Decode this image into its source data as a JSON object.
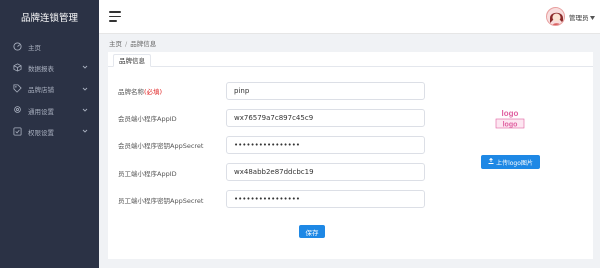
{
  "sidebar": {
    "brand": "品牌连锁管理",
    "items": [
      {
        "label": "主页",
        "icon": "dashboard-icon",
        "has_caret": false
      },
      {
        "label": "数据报表",
        "icon": "cube-icon",
        "has_caret": true
      },
      {
        "label": "品牌店铺",
        "icon": "tag-icon",
        "has_caret": true
      },
      {
        "label": "通用设置",
        "icon": "gear-icon",
        "has_caret": true
      },
      {
        "label": "权限设置",
        "icon": "checkbox-icon",
        "has_caret": true
      }
    ]
  },
  "header": {
    "user_name": "管理员"
  },
  "breadcrumb": {
    "home": "主页",
    "separator": "/",
    "current": "品牌信息"
  },
  "tabs": [
    {
      "label": "品牌信息",
      "active": true
    }
  ],
  "form": {
    "fields": [
      {
        "label": "品牌名称",
        "required_note": "(必填)",
        "value": "pinp",
        "type": "text"
      },
      {
        "label": "会员端小程序AppID",
        "required_note": "",
        "value": "wx76579a7c897c45c9",
        "type": "text"
      },
      {
        "label": "会员端小程序密钥AppSecret",
        "required_note": "",
        "value": "••••••••••••••••",
        "type": "password"
      },
      {
        "label": "员工端小程序AppID",
        "required_note": "",
        "value": "wx48abb2e87ddcbc19",
        "type": "text"
      },
      {
        "label": "员工端小程序密钥AppSecret",
        "required_note": "",
        "value": "••••••••••••••••",
        "type": "password"
      }
    ],
    "save_label": "保存"
  },
  "logo": {
    "text_top": "logo",
    "text_bottom": "logo",
    "upload_label": "上传logo图片",
    "color": "#e05fa0"
  },
  "colors": {
    "sidebar_bg": "#2b3245",
    "primary": "#1e88e5",
    "required": "#e02020"
  }
}
